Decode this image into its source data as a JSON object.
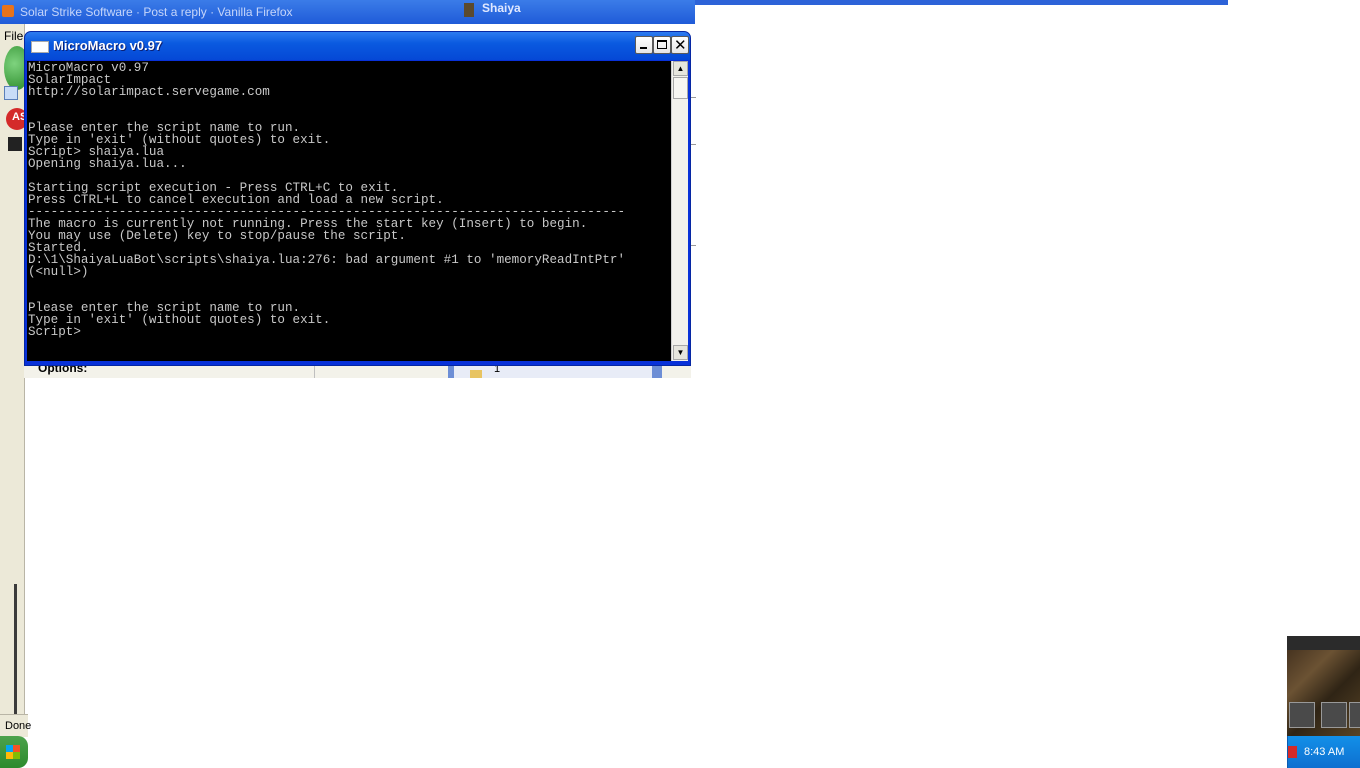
{
  "background": {
    "browser_title": "Solar Strike Software · Post a reply · Vanilla Firefox",
    "game_title": "Shaiya",
    "file_menu": "File",
    "addon_badge": "AS",
    "status_text": "Done",
    "under_options": "Options:",
    "under_folder_num": "1"
  },
  "window": {
    "title": "MicroMacro v0.97",
    "controls": {
      "minimize": "_",
      "maximize": "□",
      "close": "✕"
    }
  },
  "console": {
    "lines": [
      "MicroMacro v0.97",
      "SolarImpact",
      "http://solarimpact.servegame.com",
      "",
      "",
      "Please enter the script name to run.",
      "Type in 'exit' (without quotes) to exit.",
      "Script> shaiya.lua",
      "Opening shaiya.lua...",
      "",
      "Starting script execution - Press CTRL+C to exit.",
      "Press CTRL+L to cancel execution and load a new script.",
      "-------------------------------------------------------------------------------",
      "The macro is currently not running. Press the start key (Insert) to begin.",
      "You may use (Delete) key to stop/pause the script.",
      "Started.",
      "D:\\1\\ShaiyaLuaBot\\scripts\\shaiya.lua:276: bad argument #1 to 'memoryReadIntPtr'",
      "(<null>)",
      "",
      "",
      "Please enter the script name to run.",
      "Type in 'exit' (without quotes) to exit.",
      "Script>"
    ]
  },
  "taskbar": {
    "clock": "8:43 AM"
  },
  "icons": {
    "window_icon": "console-icon",
    "start": "windows-flag-icon",
    "scroll_up": "scroll-up-arrow-icon",
    "scroll_down": "scroll-down-arrow-icon"
  }
}
